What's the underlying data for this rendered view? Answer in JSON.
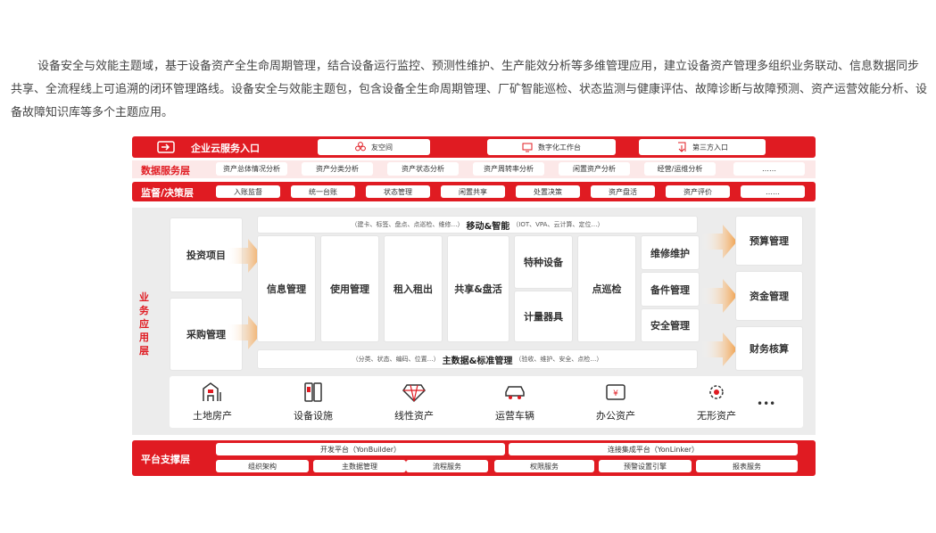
{
  "intro": "设备安全与效能主题域，基于设备资产全生命周期管理，结合设备运行监控、预测性维护、生产能效分析等多维管理应用，建立设备资产管理多组织业务联动、信息数据同步共享、全流程线上可追溯的闭环管理路线。设备安全与效能主题包，包含设备全生命周期管理、厂矿智能巡检、状态监测与健康评估、故障诊断与故障预测、资产运营效能分析、设备故障知识库等多个主题应用。",
  "cloud": {
    "title": "企业云服务入口",
    "items": [
      "友空间",
      "数字化工作台",
      "第三方入口"
    ]
  },
  "data_layer": {
    "title": "数据服务层",
    "items": [
      "资产总体情况分析",
      "资产分类分析",
      "资产状态分析",
      "资产周转率分析",
      "闲置资产分析",
      "经营/运维分析",
      "……"
    ]
  },
  "supervise_layer": {
    "title": "监督/决策层",
    "items": [
      "入账监督",
      "统一台账",
      "状态管理",
      "闲置共享",
      "处置决策",
      "资产盘活",
      "资产评价",
      "……"
    ]
  },
  "business": {
    "title": "业务应用层",
    "left": [
      "投资项目",
      "采购管理"
    ],
    "top_bar": {
      "pre": "（建卡、标签、盘点、点巡检、维修…）",
      "main": "移动&智能",
      "post": "（IOT、VPA、云计算、定位…）"
    },
    "modules": [
      "信息管理",
      "使用管理",
      "租入租出",
      "共享&盘活",
      "特种设备",
      "计量器具",
      "点巡检",
      "维修维护",
      "备件管理",
      "安全管理"
    ],
    "bottom_bar": {
      "pre": "（分类、状态、编码、位置…）",
      "main": "主数据&标准管理",
      "post": "（验收、维护、安全、点检…）"
    },
    "right": [
      "预算管理",
      "资金管理",
      "财务核算"
    ],
    "assets": [
      "土地房产",
      "设备设施",
      "线性资产",
      "运营车辆",
      "办公资产",
      "无形资产",
      "•••"
    ]
  },
  "platform": {
    "title": "平台支撑层",
    "top": [
      "开发平台（YonBuilder）",
      "连接集成平台（YonLinker）"
    ],
    "bottom": [
      "组织架构",
      "主数据管理",
      "流程服务",
      "权限服务",
      "预警设置引擎",
      "报表服务"
    ]
  },
  "colors": {
    "accent": "#e01b22",
    "panel": "#ececec",
    "arrow": "#f0a04b"
  }
}
